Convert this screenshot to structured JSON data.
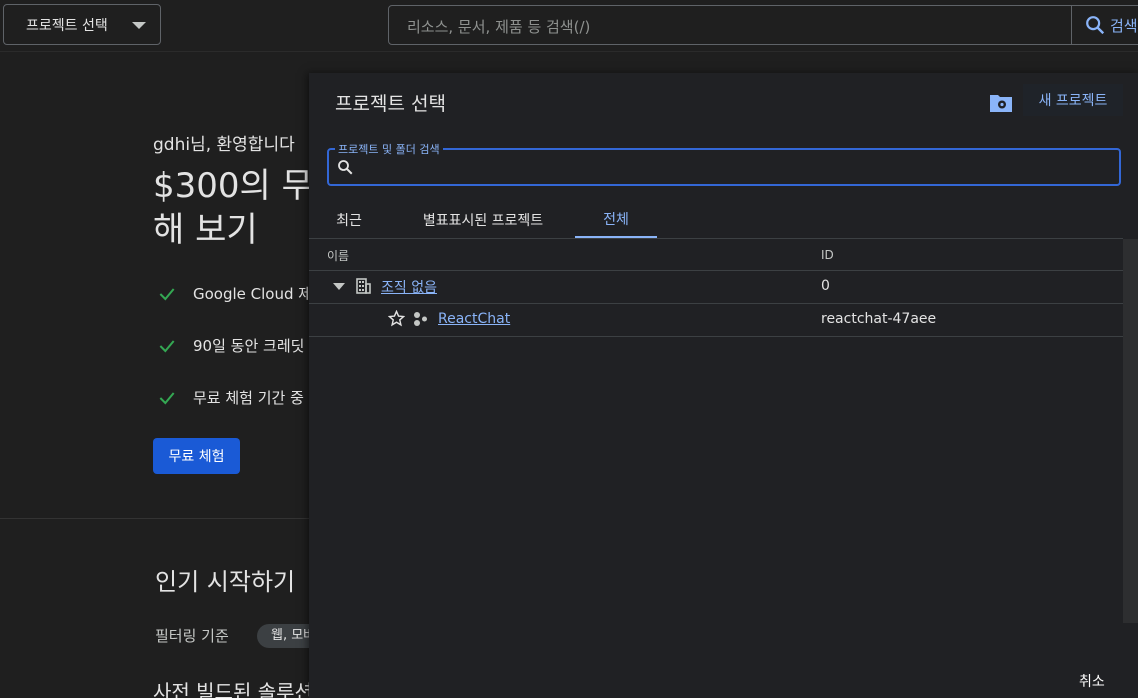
{
  "topbar": {
    "project_picker_label": "프로젝트 선택",
    "search_placeholder": "리소스, 문서, 제품 등 검색(/)",
    "search_button_label": "검색"
  },
  "background": {
    "greeting": "gdhi님, 환영합니다",
    "headline_line1": "$300의 무",
    "headline_line2": "해 보기",
    "checklist": [
      "Google Cloud 제",
      "90일 동안 크레딧",
      "무료 체험 기간 중"
    ],
    "trial_button": "무료 체험",
    "popular_heading": "인기 시작하기",
    "filter_label": "필터링 기준",
    "filter_chip": "웹, 모바",
    "prebuilt_heading": "사전 빌드된 솔루션"
  },
  "dialog": {
    "title": "프로젝트 선택",
    "new_project_label": "새 프로젝트",
    "search_legend": "프로젝트 및 폴더 검색",
    "tabs": [
      {
        "label": "최근",
        "active": false
      },
      {
        "label": "별표표시된 프로젝트",
        "active": false
      },
      {
        "label": "전체",
        "active": true
      }
    ],
    "columns": {
      "name": "이름",
      "id": "ID"
    },
    "rows": [
      {
        "name": "조직 없음",
        "id": "0"
      },
      {
        "name": "ReactChat",
        "id": "reactchat-47aee"
      }
    ],
    "cancel_label": "취소"
  },
  "colors": {
    "accent": "#8ab4f8",
    "primary_button": "#1a5ad6",
    "focus_border": "#3367d6",
    "check_green": "#34a853"
  }
}
